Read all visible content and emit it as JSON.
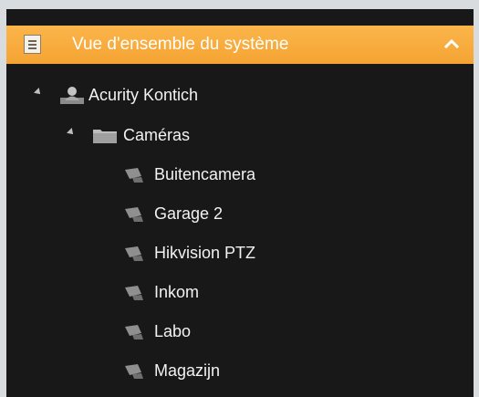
{
  "header": {
    "title": "Vue d'ensemble du système"
  },
  "tree": {
    "site": {
      "label": "Acurity Kontich"
    },
    "folder": {
      "label": "Caméras"
    },
    "cameras": [
      "Buitencamera",
      "Garage 2",
      "Hikvision PTZ",
      "Inkom",
      "Labo",
      "Magazijn"
    ]
  },
  "colors": {
    "header_accent": "#f7a838",
    "panel_bg": "#181818",
    "page_bg": "#d9dcdf"
  },
  "icons": [
    "document-icon",
    "chevron-up-icon",
    "site-user-icon",
    "folder-icon",
    "camera-icon"
  ]
}
